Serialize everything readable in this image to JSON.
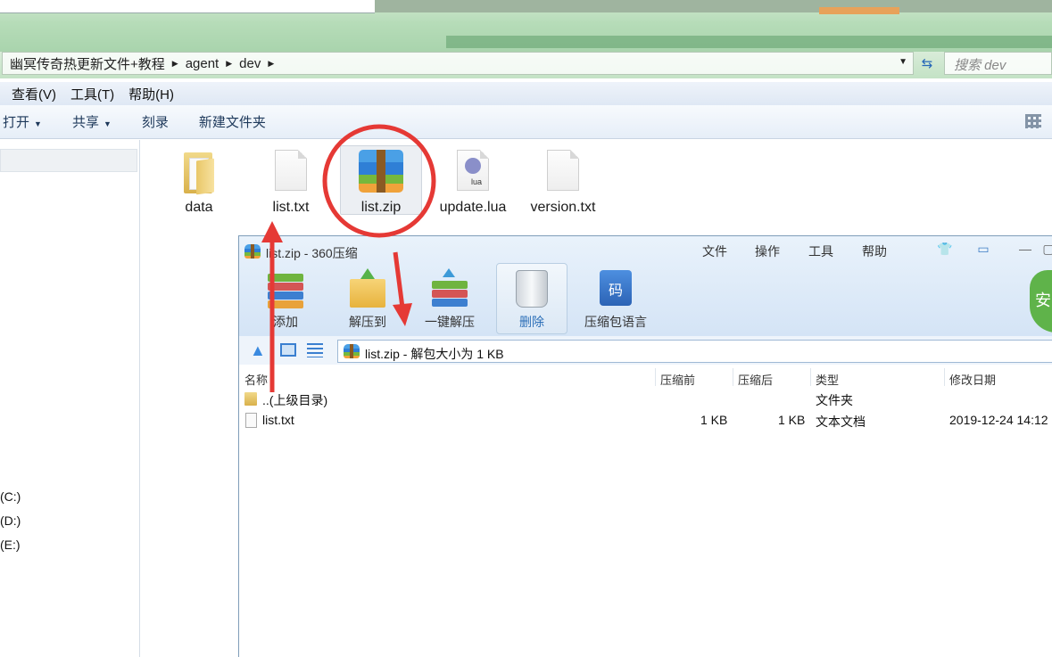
{
  "explorer": {
    "breadcrumb": [
      "幽冥传奇热更新文件+教程",
      "agent",
      "dev"
    ],
    "search_placeholder": "搜索 dev",
    "menu": [
      "查看(V)",
      "工具(T)",
      "帮助(H)"
    ],
    "commands": [
      {
        "label": "打开",
        "dropdown": true
      },
      {
        "label": "共享",
        "dropdown": true
      },
      {
        "label": "刻录",
        "dropdown": false
      },
      {
        "label": "新建文件夹",
        "dropdown": false
      }
    ],
    "drives": [
      "(C:)",
      "(D:)",
      "(E:)"
    ],
    "files": [
      {
        "name": "data",
        "icon": "folder-icon"
      },
      {
        "name": "list.txt",
        "icon": "text-file-icon"
      },
      {
        "name": "list.zip",
        "icon": "zip-archive-icon",
        "selected": true
      },
      {
        "name": "update.lua",
        "icon": "lua-file-icon"
      },
      {
        "name": "version.txt",
        "icon": "text-file-icon"
      }
    ]
  },
  "zip_window": {
    "title": "list.zip - 360压缩",
    "menu": [
      "文件",
      "操作",
      "工具",
      "帮助"
    ],
    "toolbar": [
      "添加",
      "解压到",
      "一键解压",
      "删除",
      "压缩包语言"
    ],
    "shield_text": "安",
    "path_text": "list.zip - 解包大小为 1 KB",
    "columns": [
      "名称",
      "压缩前",
      "压缩后",
      "类型",
      "修改日期"
    ],
    "rows": [
      {
        "name": "..(上级目录)",
        "before": "",
        "after": "",
        "type": "文件夹",
        "date": "",
        "icon": "folder-icon"
      },
      {
        "name": "list.txt",
        "before": "1 KB",
        "after": "1 KB",
        "type": "文本文档",
        "date": "2019-12-24 14:12",
        "icon": "text-file-icon"
      }
    ]
  },
  "colors": {
    "annotation_red": "#e53935",
    "accent_blue": "#3a7fd0"
  }
}
